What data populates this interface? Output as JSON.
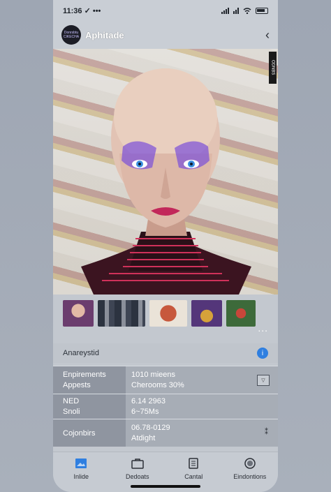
{
  "status": {
    "time": "11:36 ✓ •••"
  },
  "header": {
    "avatar_text": "Donrsbtu CIKECHA",
    "title": "Aphitade"
  },
  "hero": {
    "side_tag": "ODNBS"
  },
  "thumbnails": {
    "more_label": "..."
  },
  "author": {
    "name": "Anareystid"
  },
  "details": {
    "rows": [
      {
        "labels": [
          "Enpirements",
          "Appests"
        ],
        "values": [
          "1010 mieens",
          "Cherooms 30%"
        ]
      },
      {
        "labels": [
          "NED",
          "Snoli"
        ],
        "values": [
          "6.14 2963",
          "6~75Ms"
        ]
      },
      {
        "labels": [
          "Cojonbirs"
        ],
        "values": [
          "06.78-0129",
          "Atdight"
        ]
      }
    ]
  },
  "tabs": [
    {
      "label": "Inlide",
      "icon": "image-icon"
    },
    {
      "label": "Dedoats",
      "icon": "briefcase-icon"
    },
    {
      "label": "Cantal",
      "icon": "document-icon"
    },
    {
      "label": "Eindontions",
      "icon": "circle-icon"
    }
  ],
  "colors": {
    "accent": "#2f7fe0",
    "makeup": "#7a4fd8",
    "lips": "#c2285a"
  }
}
